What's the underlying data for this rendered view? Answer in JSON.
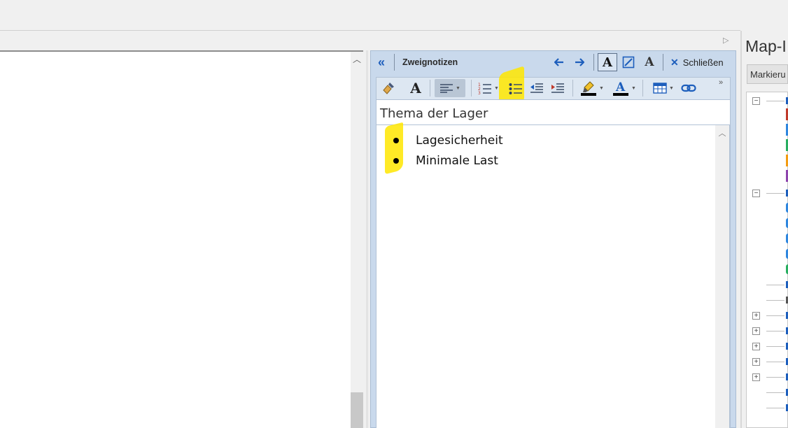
{
  "notes_panel": {
    "title": "Zweignotizen",
    "close_label": "Schließen",
    "note_title": "Thema der Lager",
    "bullets": [
      "Lagesicherheit",
      "Minimale Last"
    ]
  },
  "map_panel": {
    "title": "Map-I",
    "filter": "Markieru"
  },
  "icons": {
    "collapse": "double-chevron-left-icon",
    "prev": "arrow-left-icon",
    "next": "arrow-right-icon",
    "format_text": "text-format-icon",
    "edit": "edit-icon",
    "close": "close-icon",
    "brush": "format-painter-icon",
    "font": "font-icon",
    "align": "align-left-icon",
    "numbered_list": "numbered-list-icon",
    "bullet_list": "bullet-list-icon",
    "outdent": "outdent-icon",
    "indent": "indent-icon",
    "highlight": "highlight-icon",
    "font_color": "font-color-icon",
    "table": "table-icon",
    "link": "link-icon"
  },
  "colors": {
    "panel_blue": "#c9d9ec",
    "accent_blue": "#1d5ebc",
    "highlight_yellow": "#ffe600"
  }
}
